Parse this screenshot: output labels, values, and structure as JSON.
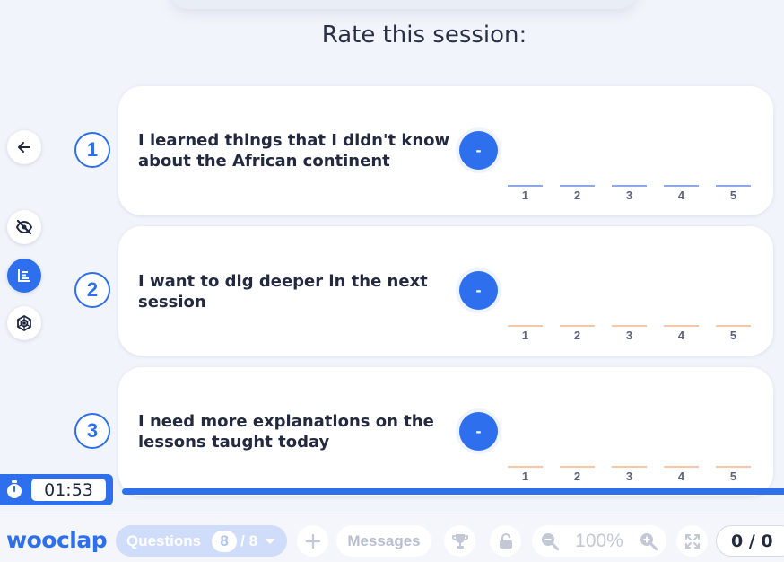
{
  "title": "Rate this session:",
  "questions": [
    {
      "number": "1",
      "text": "I learned things that I didn't know about the African continent",
      "button": "-",
      "line_color": "#8ea9e8"
    },
    {
      "number": "2",
      "text": "I want to dig deeper in the next session",
      "button": "-",
      "line_color": "#f3c7a8"
    },
    {
      "number": "3",
      "text": "I need more explanations on the lessons taught today",
      "button": "-",
      "line_color": "#f3c7a8"
    }
  ],
  "scale": [
    "1",
    "2",
    "3",
    "4",
    "5"
  ],
  "timer": {
    "value": "01:53"
  },
  "toolbar": {
    "logo": "wooclap",
    "questions_label": "Questions",
    "questions_current": "8",
    "questions_total": "/ 8",
    "messages_label": "Messages",
    "zoom": "100%",
    "score": "0 / 0"
  },
  "icons": {
    "back": "arrow-left-icon",
    "hide": "eye-slash-icon",
    "results": "bar-chart-icon",
    "web": "spider-web-icon",
    "timer": "stopwatch-icon",
    "add": "plus-icon",
    "trophy": "trophy-icon",
    "lock": "unlock-icon",
    "zoom_out": "zoom-out-icon",
    "zoom_in": "zoom-in-icon",
    "fullscreen": "fullscreen-icon"
  },
  "colors": {
    "accent": "#2d6fec",
    "background": "#f1f4fa"
  }
}
